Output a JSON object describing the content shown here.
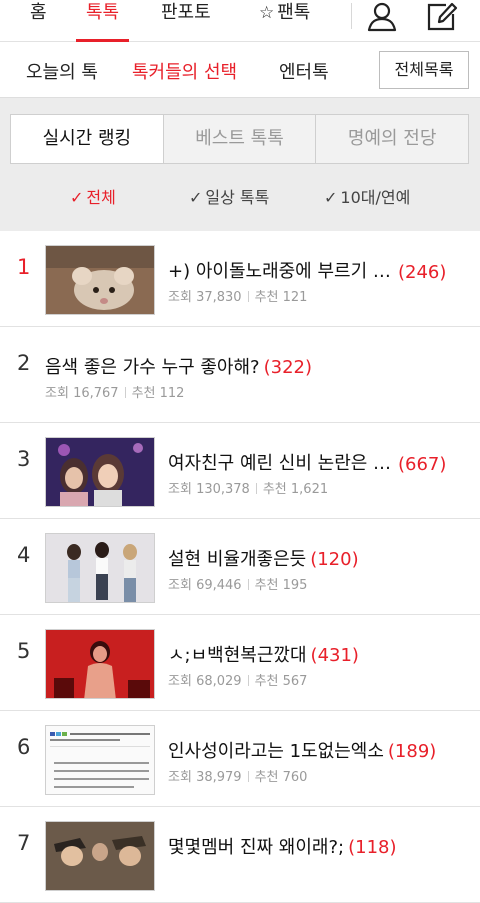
{
  "top_nav": {
    "tabs": [
      {
        "label": "홈"
      },
      {
        "label": "톡톡",
        "active": true
      },
      {
        "label": "판포토"
      },
      {
        "label": "팬톡",
        "icon": "star-icon"
      }
    ],
    "icons": [
      "user-icon",
      "edit-icon"
    ],
    "accent_color": "#e8202a"
  },
  "sub_nav": {
    "items": [
      {
        "label": "오늘의 톡"
      },
      {
        "label": "톡커들의 선택",
        "active": true
      },
      {
        "label": "엔터톡"
      }
    ],
    "all_list_button": "전체목록"
  },
  "segments": [
    "실시간 랭킹",
    "베스트 톡톡",
    "명예의 전당"
  ],
  "active_segment": "실시간 랭킹",
  "filters": [
    {
      "label": "전체",
      "active": true
    },
    {
      "label": "일상 톡톡"
    },
    {
      "label": "10대/연예"
    }
  ],
  "posts": [
    {
      "rank": "1",
      "title": "+) 아이돌노래중에 부르기 힘...",
      "comments": "(246)",
      "views": "37,830",
      "recs": "121",
      "has_image": true
    },
    {
      "rank": "2",
      "title": "음색 좋은 가수 누구 좋아해?",
      "comments": "(322)",
      "views": "16,767",
      "recs": "112",
      "has_image": false
    },
    {
      "rank": "3",
      "title": "여자친구 예린 신비 논란은 참...",
      "comments": "(667)",
      "views": "130,378",
      "recs": "1,621",
      "has_image": true
    },
    {
      "rank": "4",
      "title": "설현 비율개좋은듯",
      "comments": "(120)",
      "views": "69,446",
      "recs": "195",
      "has_image": true
    },
    {
      "rank": "5",
      "title": "ㅅ;ㅂ백현복근깠대",
      "comments": "(431)",
      "views": "68,029",
      "recs": "567",
      "has_image": true
    },
    {
      "rank": "6",
      "title": "인사성이라고는 1도없는엑소",
      "comments": "(189)",
      "views": "38,979",
      "recs": "760",
      "has_image": true
    },
    {
      "rank": "7",
      "title": "몇몇멤버 진짜 왜이래?;",
      "comments": "(118)",
      "views": "",
      "recs": "",
      "has_image": true
    }
  ],
  "labels": {
    "views_prefix": "조회",
    "recs_prefix": "추천"
  }
}
